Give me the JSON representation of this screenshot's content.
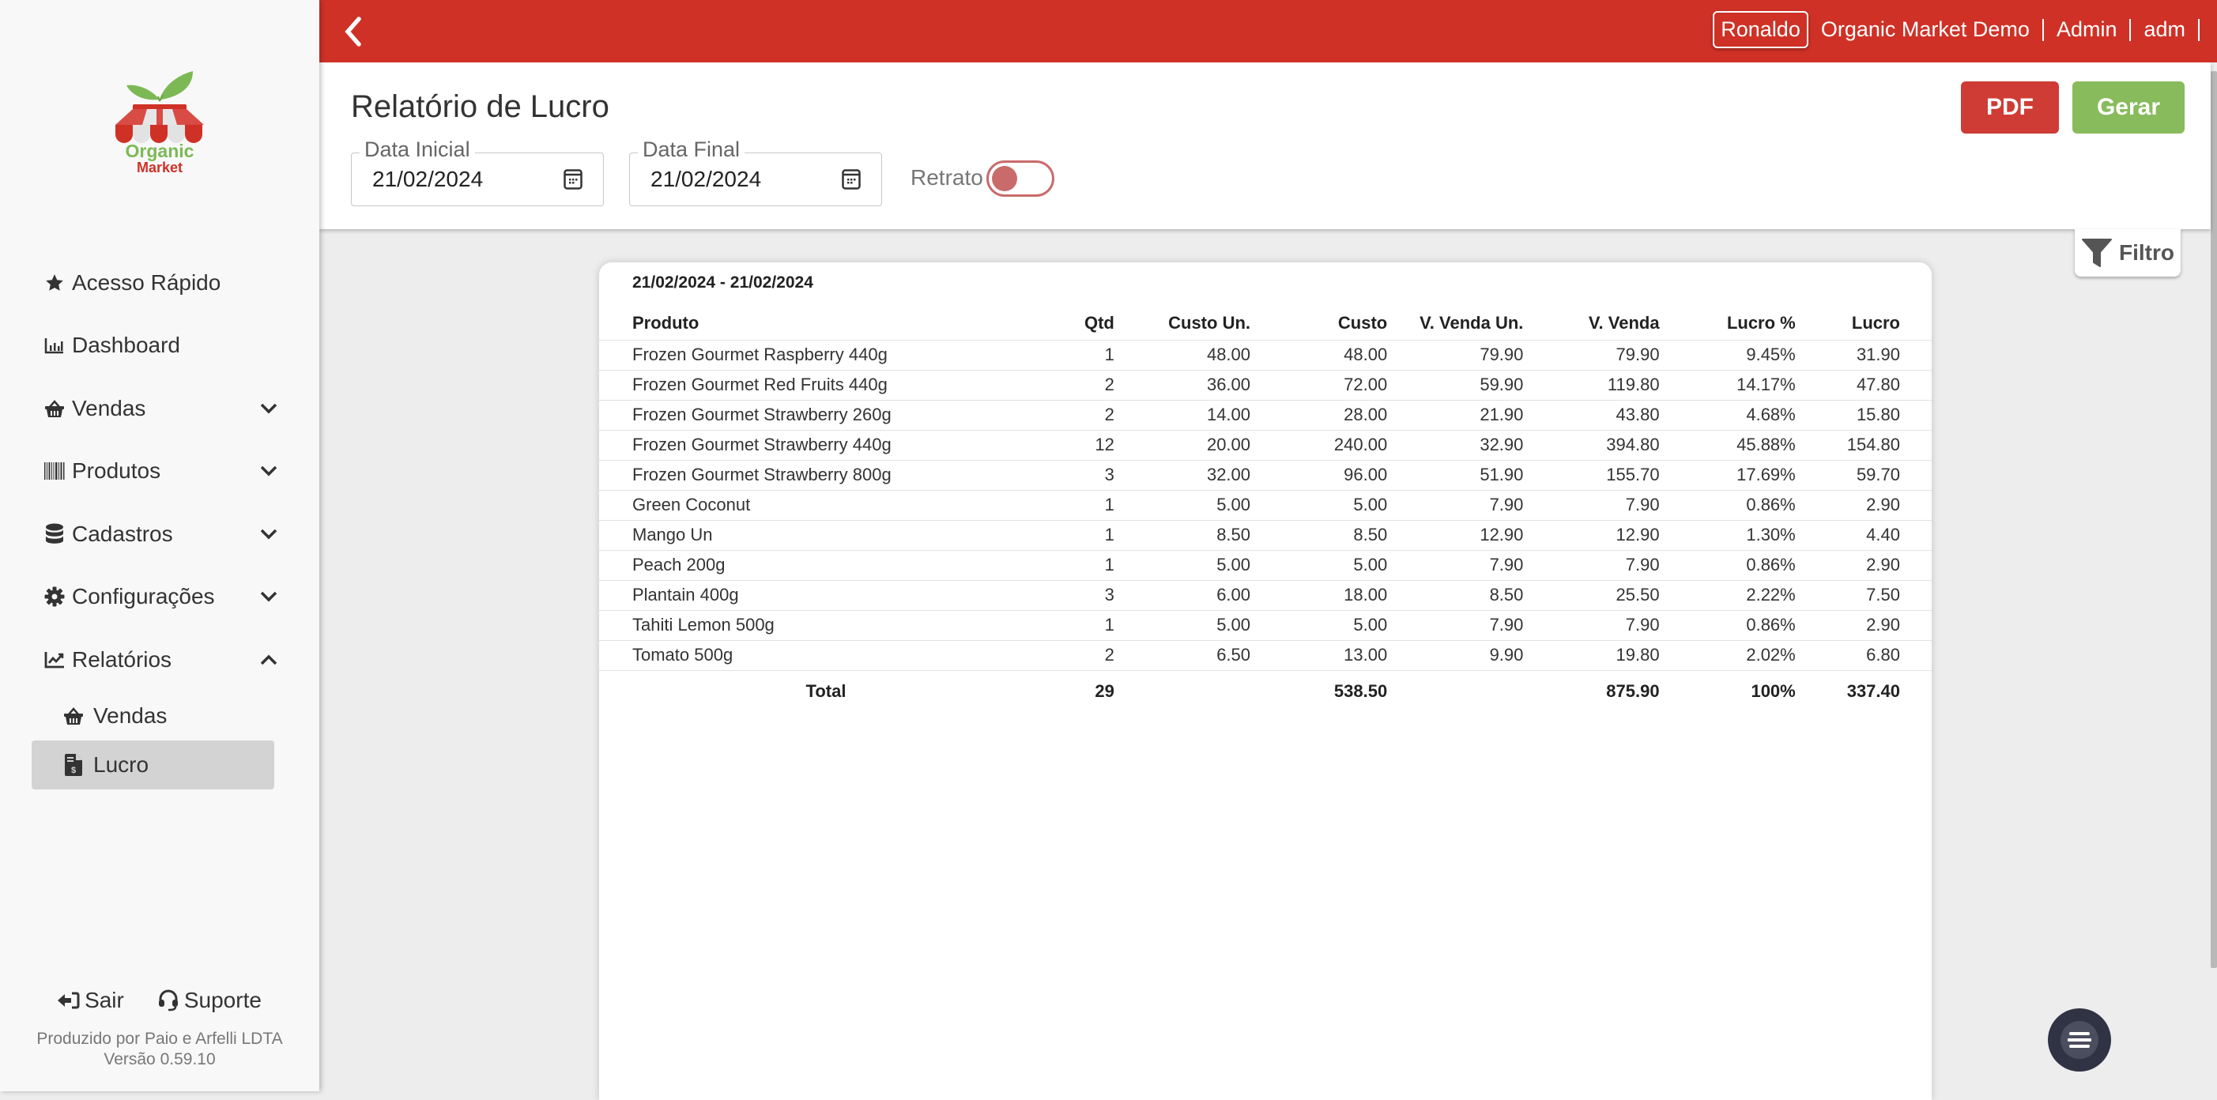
{
  "brand": {
    "name_line1": "Organic",
    "name_line2": "Market",
    "green": "#7cb955",
    "red": "#cf3126"
  },
  "topbar": {
    "back_icon": "chevron-left-icon",
    "user_name": "Ronaldo",
    "company": "Organic Market Demo",
    "role": "Admin",
    "login": "adm"
  },
  "sidebar": {
    "items": [
      {
        "label": "Acesso Rápido",
        "icon": "star-icon",
        "expandable": false
      },
      {
        "label": "Dashboard",
        "icon": "chart-bar-icon",
        "expandable": false
      },
      {
        "label": "Vendas",
        "icon": "basket-icon",
        "expandable": true,
        "expanded": false
      },
      {
        "label": "Produtos",
        "icon": "barcode-icon",
        "expandable": true,
        "expanded": false
      },
      {
        "label": "Cadastros",
        "icon": "database-icon",
        "expandable": true,
        "expanded": false
      },
      {
        "label": "Configurações",
        "icon": "gear-icon",
        "expandable": true,
        "expanded": false
      },
      {
        "label": "Relatórios",
        "icon": "chart-line-icon",
        "expandable": true,
        "expanded": true
      }
    ],
    "subitems": [
      {
        "label": "Vendas",
        "icon": "basket-icon",
        "active": false
      },
      {
        "label": "Lucro",
        "icon": "invoice-dollar-icon",
        "active": true
      }
    ],
    "footer": {
      "logout_label": "Sair",
      "support_label": "Suporte",
      "credits": "Produzido por Paio e Arfelli LDTA",
      "version": "Versão 0.59.10"
    }
  },
  "header": {
    "title": "Relatório de Lucro",
    "start_date_label": "Data Inicial",
    "start_date_value": "21/02/2024",
    "end_date_label": "Data Final",
    "end_date_value": "21/02/2024",
    "portrait_label": "Retrato",
    "portrait_on": false,
    "pdf_label": "PDF",
    "generate_label": "Gerar",
    "filter_label": "Filtro"
  },
  "report": {
    "period": "21/02/2024 - 21/02/2024",
    "columns": [
      "Produto",
      "Qtd",
      "Custo Un.",
      "Custo",
      "V. Venda Un.",
      "V. Venda",
      "Lucro %",
      "Lucro"
    ],
    "rows": [
      [
        "Frozen Gourmet Raspberry 440g",
        "1",
        "48.00",
        "48.00",
        "79.90",
        "79.90",
        "9.45%",
        "31.90"
      ],
      [
        "Frozen Gourmet Red Fruits 440g",
        "2",
        "36.00",
        "72.00",
        "59.90",
        "119.80",
        "14.17%",
        "47.80"
      ],
      [
        "Frozen Gourmet Strawberry 260g",
        "2",
        "14.00",
        "28.00",
        "21.90",
        "43.80",
        "4.68%",
        "15.80"
      ],
      [
        "Frozen Gourmet Strawberry 440g",
        "12",
        "20.00",
        "240.00",
        "32.90",
        "394.80",
        "45.88%",
        "154.80"
      ],
      [
        "Frozen Gourmet Strawberry 800g",
        "3",
        "32.00",
        "96.00",
        "51.90",
        "155.70",
        "17.69%",
        "59.70"
      ],
      [
        "Green Coconut",
        "1",
        "5.00",
        "5.00",
        "7.90",
        "7.90",
        "0.86%",
        "2.90"
      ],
      [
        "Mango Un",
        "1",
        "8.50",
        "8.50",
        "12.90",
        "12.90",
        "1.30%",
        "4.40"
      ],
      [
        "Peach 200g",
        "1",
        "5.00",
        "5.00",
        "7.90",
        "7.90",
        "0.86%",
        "2.90"
      ],
      [
        "Plantain 400g",
        "3",
        "6.00",
        "18.00",
        "8.50",
        "25.50",
        "2.22%",
        "7.50"
      ],
      [
        "Tahiti Lemon 500g",
        "1",
        "5.00",
        "5.00",
        "7.90",
        "7.90",
        "0.86%",
        "2.90"
      ],
      [
        "Tomato 500g",
        "2",
        "6.50",
        "13.00",
        "9.90",
        "19.80",
        "2.02%",
        "6.80"
      ]
    ],
    "total": [
      "Total",
      "29",
      "",
      "538.50",
      "",
      "875.90",
      "100%",
      "337.40"
    ]
  }
}
